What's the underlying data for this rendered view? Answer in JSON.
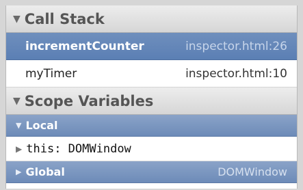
{
  "call_stack": {
    "title": "Call Stack",
    "frames": [
      {
        "function": "incrementCounter",
        "location": "inspector.html:26",
        "selected": true
      },
      {
        "function": "myTimer",
        "location": "inspector.html:10",
        "selected": false
      }
    ]
  },
  "scope_variables": {
    "title": "Scope Variables",
    "local": {
      "label": "Local"
    },
    "local_properties": [
      {
        "name": "this",
        "value": "DOMWindow"
      }
    ],
    "global": {
      "label": "Global",
      "value": "DOMWindow"
    }
  },
  "icons": {
    "expanded": "triangle-down",
    "collapsed": "triangle-right"
  },
  "colors": {
    "selection": "#5b7fb4",
    "scope_bar": "#7a96c0",
    "header": "#dddddd"
  }
}
